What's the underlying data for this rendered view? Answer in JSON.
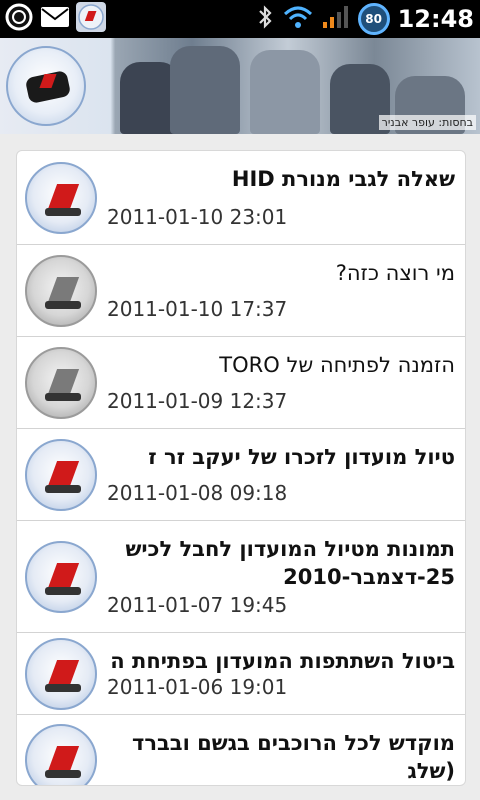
{
  "status_bar": {
    "time": "12:48",
    "battery": "80",
    "icons": [
      "circle-app-icon",
      "mail-icon",
      "app-logo-icon",
      "bluetooth-icon",
      "wifi-icon",
      "signal-icon",
      "battery-icon"
    ]
  },
  "banner": {
    "sponsor_text": "בחסות: עופר אבניר"
  },
  "posts": [
    {
      "title": "שאלה לגבי מנורת HID",
      "date": "2011-01-10 23:01",
      "bold": true,
      "thumb": "blue"
    },
    {
      "title": "מי רוצה כזה?",
      "date": "2011-01-10 17:37",
      "bold": false,
      "thumb": "gray"
    },
    {
      "title": "הזמנה לפתיחה של TORO",
      "date": "2011-01-09 12:37",
      "bold": false,
      "thumb": "gray"
    },
    {
      "title": "טיול מועדון לזכרו של יעקב זר ז",
      "date": "2011-01-08 09:18",
      "bold": true,
      "thumb": "blue"
    },
    {
      "title": "תמונות מטיול המועדון לחבל לכיש 25-דצמבר-2010",
      "date": "2011-01-07 19:45",
      "bold": true,
      "thumb": "blue"
    },
    {
      "title": "ביטול השתתפות המועדון בפתיחת ה",
      "date": "2011-01-06 19:01",
      "bold": true,
      "thumb": "blue"
    },
    {
      "title": "מוקדש לכל הרוכבים בגשם ובברד (שלג",
      "date": "",
      "bold": true,
      "thumb": "blue"
    }
  ]
}
